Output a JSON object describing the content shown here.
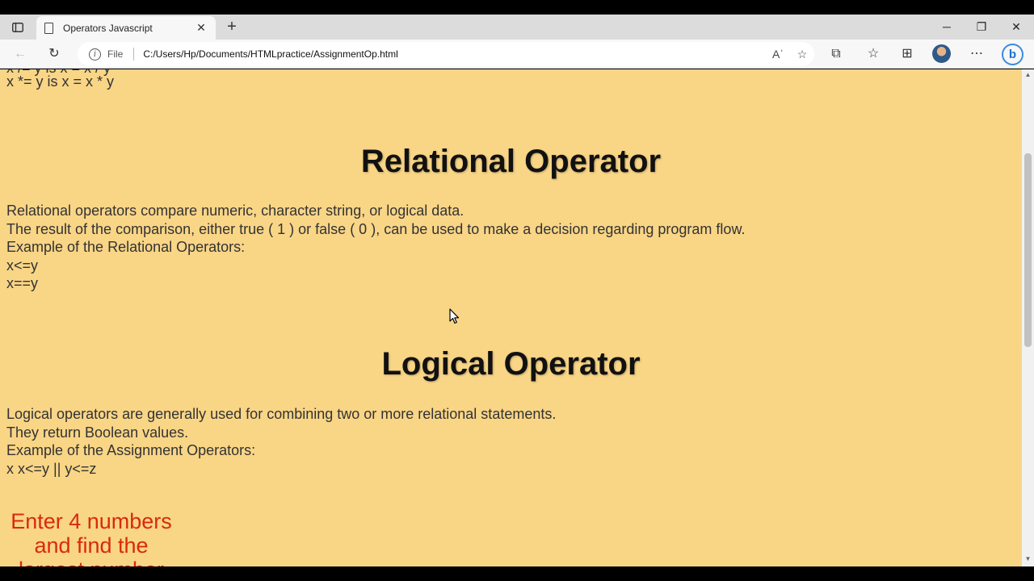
{
  "browser": {
    "tab_title": "Operators Javascript",
    "file_label": "File",
    "url": "C:/Users/Hp/Documents/HTMLpractice/AssignmentOp.html",
    "read_aloud_label": "Aʾ"
  },
  "page": {
    "top_partial": "x /= y is x = x / y",
    "top_line": "x *= y is x = x * y",
    "relational": {
      "heading": "Relational Operator",
      "lines": [
        "Relational operators compare numeric, character string, or logical data.",
        "The result of the comparison, either true ( 1 ) or false ( 0 ), can be used to make a decision regarding program flow.",
        "Example of the Relational Operators:",
        "x<=y",
        "x==y"
      ]
    },
    "logical": {
      "heading": "Logical Operator",
      "lines": [
        "Logical operators are generally used for combining two or more relational statements.",
        "They return Boolean values.",
        "Example of the Assignment Operators:",
        "x x<=y || y<=z"
      ]
    },
    "task_heading": [
      "Enter 4 numbers",
      "and find the",
      "largest number"
    ]
  },
  "colors": {
    "page_background": "#f9d586",
    "task_heading": "#d92a0e"
  }
}
